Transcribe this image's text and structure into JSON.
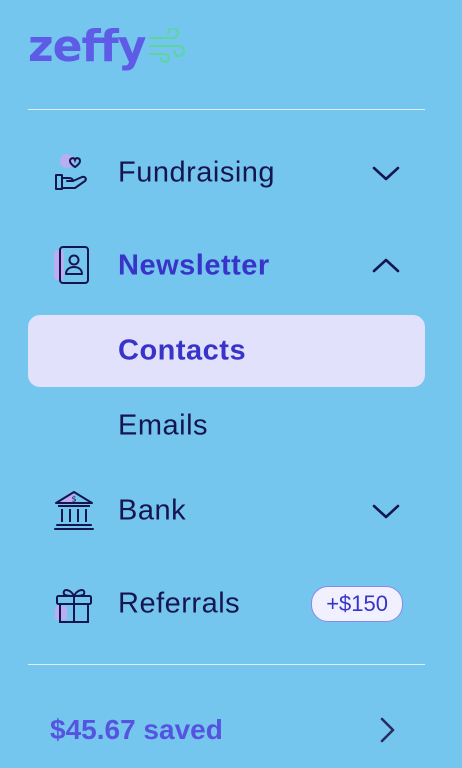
{
  "brand": {
    "name": "zeffy",
    "color": "#5e5be6",
    "accent": "#5fd3a7"
  },
  "nav": {
    "items": [
      {
        "label": "Fundraising",
        "icon": "hand-heart-icon",
        "state": "collapsed"
      },
      {
        "label": "Newsletter",
        "icon": "contact-card-icon",
        "state": "expanded",
        "active": true,
        "children": [
          {
            "label": "Contacts",
            "selected": true
          },
          {
            "label": "Emails",
            "selected": false
          }
        ]
      },
      {
        "label": "Bank",
        "icon": "bank-icon",
        "state": "collapsed"
      },
      {
        "label": "Referrals",
        "icon": "gift-icon",
        "badge": "+$150"
      }
    ]
  },
  "footer": {
    "saved_text": "$45.67 saved",
    "icon": "chevron-right-icon"
  },
  "colors": {
    "background": "#74c6ee",
    "active_text": "#3834c9",
    "selected_bg": "#e1e1fb",
    "text": "#15154f"
  }
}
